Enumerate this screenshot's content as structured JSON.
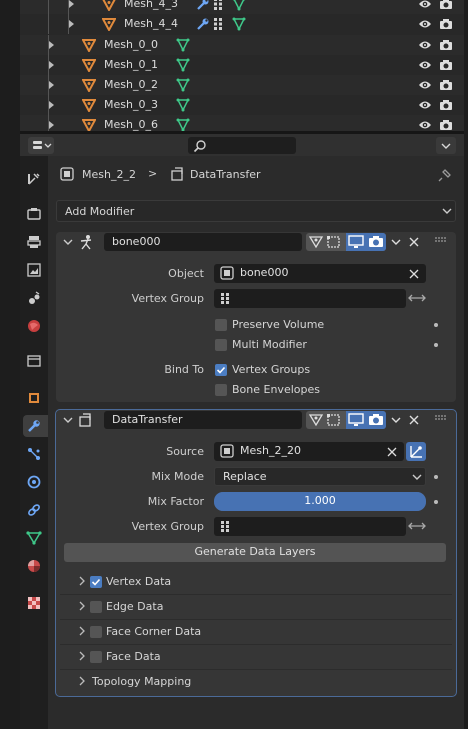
{
  "outliner": {
    "rows": [
      {
        "name": "Mesh_4_3"
      },
      {
        "name": "Mesh_4_4"
      },
      {
        "name": "Mesh_0_0"
      },
      {
        "name": "Mesh_0_1"
      },
      {
        "name": "Mesh_0_2"
      },
      {
        "name": "Mesh_0_3"
      },
      {
        "name": "Mesh_0_6"
      }
    ]
  },
  "breadcrumb": {
    "object": "Mesh_2_2",
    "separator": ">",
    "modifier": "DataTransfer"
  },
  "add_modifier": {
    "label": "Add Modifier"
  },
  "armature_mod": {
    "name": "bone000",
    "object_label": "Object",
    "object_value": "bone000",
    "vertex_group_label": "Vertex Group",
    "vertex_group_value": "",
    "preserve_volume": "Preserve Volume",
    "multi_modifier": "Multi Modifier",
    "bind_to_label": "Bind To",
    "vertex_groups": "Vertex Groups",
    "bone_envelopes": "Bone Envelopes"
  },
  "datatransfer_mod": {
    "name": "DataTransfer",
    "source_label": "Source",
    "source_value": "Mesh_2_20",
    "mix_mode_label": "Mix Mode",
    "mix_mode_value": "Replace",
    "mix_factor_label": "Mix Factor",
    "mix_factor_value": "1.000",
    "mix_factor_fraction": 1.0,
    "vertex_group_label": "Vertex Group",
    "vertex_group_value": "",
    "generate_label": "Generate Data Layers",
    "vertex_data": "Vertex Data",
    "edge_data": "Edge Data",
    "face_corner_data": "Face Corner Data",
    "face_data": "Face Data",
    "topology_mapping": "Topology Mapping"
  },
  "colors": {
    "accent_blue": "#4772b3",
    "mesh_orange": "#e08a3c",
    "vertex_green": "#3fc98a",
    "wrench_blue": "#6ea7f5"
  }
}
